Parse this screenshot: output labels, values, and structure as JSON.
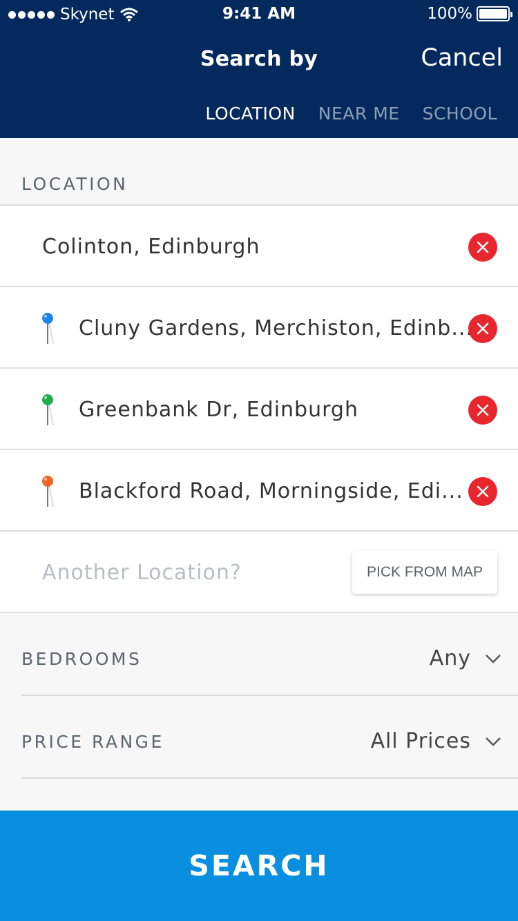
{
  "status_bar": {
    "carrier": "Skynet",
    "time": "9:41 AM",
    "battery": "100%"
  },
  "header": {
    "title": "Search by",
    "cancel_label": "Cancel",
    "tabs": [
      {
        "label": "LOCATION",
        "active": true
      },
      {
        "label": "NEAR ME",
        "active": false
      },
      {
        "label": "SCHOOL",
        "active": false
      }
    ]
  },
  "location_section": {
    "label": "LOCATION",
    "items": [
      {
        "text": "Colinton, Edinburgh",
        "pin": null
      },
      {
        "text": "Cluny Gardens, Merchiston, Edinb...",
        "pin": "#1e88e5"
      },
      {
        "text": "Greenbank Dr, Edinburgh",
        "pin": "#1fae4b"
      },
      {
        "text": "Blackford Road, Morningside, Edi...",
        "pin": "#f26522"
      }
    ],
    "placeholder": "Another Location?",
    "pick_from_map": "PICK FROM MAP"
  },
  "filters": {
    "bedrooms": {
      "label": "BEDROOMS",
      "value": "Any"
    },
    "price_range": {
      "label": "PRICE RANGE",
      "value": "All Prices"
    }
  },
  "search_button": "SEARCH",
  "colors": {
    "header": "#042a5d",
    "accent": "#0a8ee0",
    "remove": "#e8262d"
  }
}
